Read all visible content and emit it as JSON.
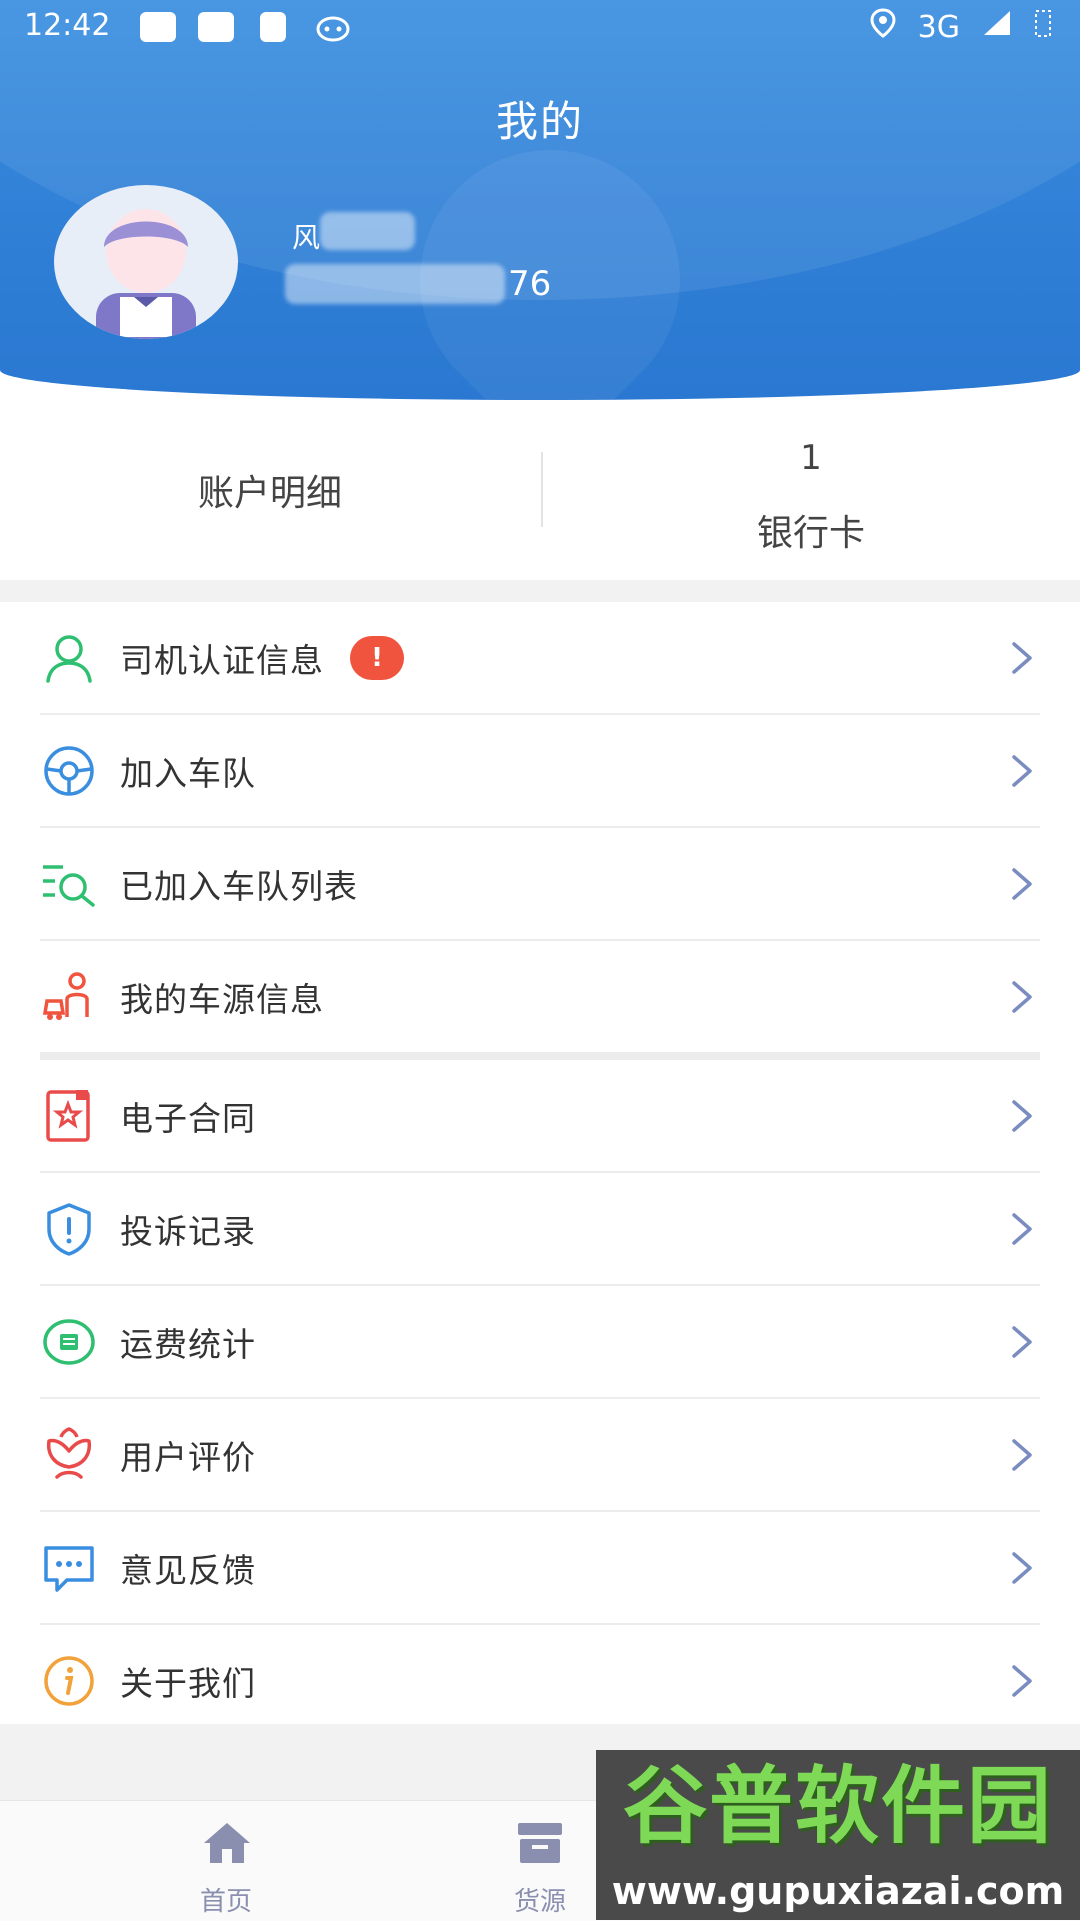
{
  "status_bar": {
    "time": "12:42",
    "network": "3G"
  },
  "header": {
    "title": "我的"
  },
  "user": {
    "name_prefix": "风",
    "phone_suffix": "76"
  },
  "account": {
    "detail_label": "账户明细",
    "bank_count": "1",
    "bank_label": "银行卡"
  },
  "menu": [
    {
      "label": "司机认证信息",
      "icon": "person-icon",
      "badge": "!"
    },
    {
      "label": "加入车队",
      "icon": "steering-wheel-icon"
    },
    {
      "label": "已加入车队列表",
      "icon": "list-search-icon"
    },
    {
      "label": "我的车源信息",
      "icon": "driver-car-icon"
    },
    {
      "label": "电子合同",
      "icon": "contract-icon"
    },
    {
      "label": "投诉记录",
      "icon": "shield-alert-icon"
    },
    {
      "label": "运费统计",
      "icon": "freight-stats-icon"
    },
    {
      "label": "用户评价",
      "icon": "flower-icon"
    },
    {
      "label": "意见反馈",
      "icon": "chat-bubble-icon"
    },
    {
      "label": "关于我们",
      "icon": "info-icon"
    }
  ],
  "bottom_nav": [
    {
      "label": "首页",
      "icon": "home-icon"
    },
    {
      "label": "货源",
      "icon": "cargo-icon"
    }
  ],
  "watermark": {
    "title": "谷普软件园",
    "url": "www.gupuxiazai.com"
  },
  "colors": {
    "header_blue": "#2f7fd6",
    "badge_red": "#f0533e",
    "icon_green": "#2fbf71",
    "icon_blue": "#3a8ee0",
    "icon_red": "#e94b4b",
    "icon_orange": "#f2a23a",
    "nav_gray": "#8a8fb0"
  }
}
